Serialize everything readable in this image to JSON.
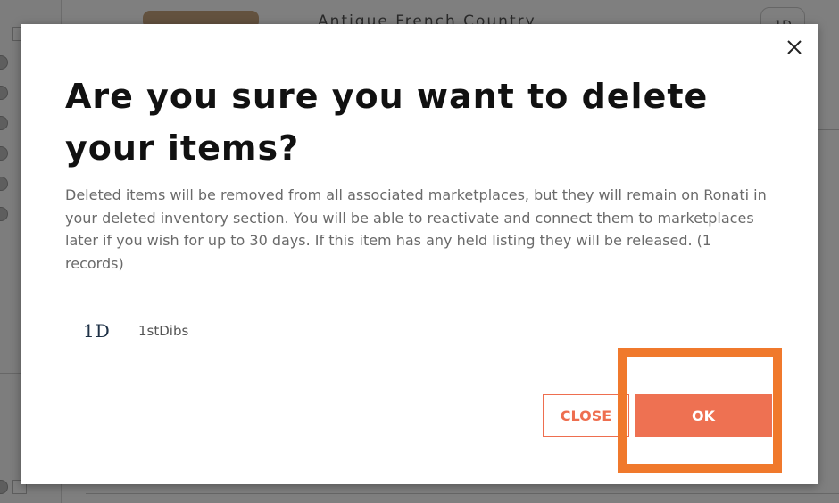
{
  "background": {
    "item_title": "Antique French Country",
    "item_badge": "1D"
  },
  "modal": {
    "title": "Are you sure you want to delete your items?",
    "description": "Deleted items will be removed from all associated marketplaces, but they will remain on Ronati in your deleted inventory section. You will be able to reactivate and connect them to marketplaces later if you wish for up to 30 days. If this item has any held listing they will be released. (1 records)",
    "marketplaces": [
      {
        "logo": "1D",
        "name": "1stDibs"
      }
    ],
    "close_label": "CLOSE",
    "ok_label": "OK",
    "close_icon": "close-icon"
  },
  "colors": {
    "accent": "#ee7152",
    "highlight": "#f0792c",
    "title": "#111111",
    "body_text": "#6a6a6a"
  }
}
